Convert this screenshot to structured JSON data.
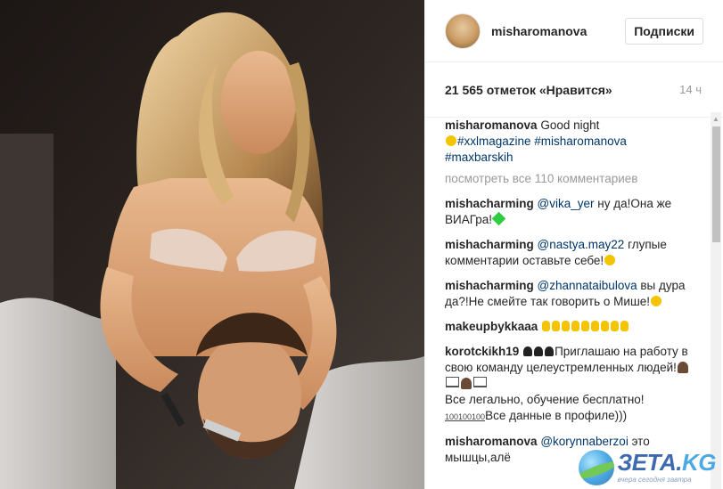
{
  "post": {
    "username": "misharomanova",
    "follow_label": "Подписки",
    "likes": "21 565 отметок «Нравится»",
    "time_ago": "14 ч"
  },
  "caption": {
    "user": "misharomanova",
    "text": "Good night",
    "hashtags": "#xxlmagazine #misharomanova",
    "hashtags2": "#maxbarskih"
  },
  "load_more": "посмотреть все 110 комментариев",
  "comments": [
    {
      "user": "mishacharming",
      "mention": "@vika_yer",
      "text": "ну да!Она же ВИАГра!"
    },
    {
      "user": "mishacharming",
      "mention": "@nastya.may22",
      "text": "глупые комментарии оставьте себе!"
    },
    {
      "user": "mishacharming",
      "mention": "@zhannataibulova",
      "text": "вы дура да?!Не смейте так говорить о Мише!"
    },
    {
      "user": "makeupbykkaaa",
      "mention": "",
      "text": ""
    },
    {
      "user": "korotckikh19",
      "text1": "Приглашаю на работу в свою команду целеустремленных людей!",
      "text2": "Все легально, обучение бесплатно!",
      "badge": "100100100",
      "text3": "Все данные в профиле)))"
    },
    {
      "user": "misharomanova",
      "mention": "@korynnaberzoi",
      "text": "это мышцы,алё"
    }
  ],
  "watermark": {
    "brand": "ЗЕТА.",
    "brand_kg": "KG",
    "tagline": "вчера сегодня завтра"
  },
  "colors": {
    "link": "#003569",
    "muted": "#999999",
    "border": "#efefef"
  }
}
